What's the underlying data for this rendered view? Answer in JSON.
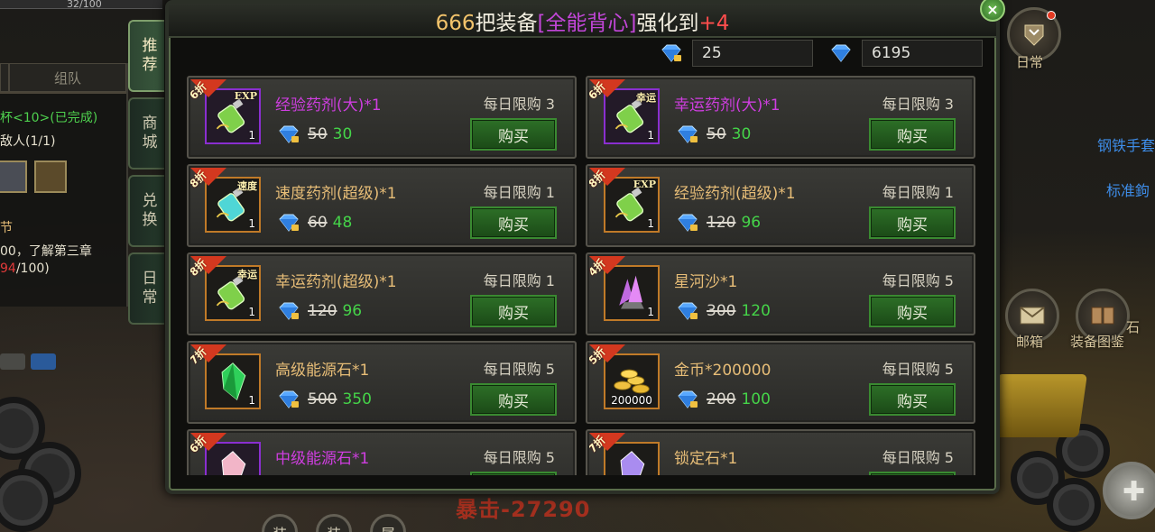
{
  "hud": {
    "hp_text": "32/100",
    "damage_text": "暴击-27290",
    "daily_label": "日常",
    "mail_label": "邮箱",
    "atlas_label": "装备图鉴",
    "side_blue_1": "钢铁手套",
    "side_blue_2": "标准鉤",
    "atlas_partial": "石",
    "bottom_buttons": [
      "装",
      "装",
      "属"
    ]
  },
  "quest": {
    "tabs": [
      "组队"
    ],
    "line1": "杯<10>(已完成)",
    "line2": "敌人(1/1)",
    "line3": "节",
    "line4": "00，了解第三章",
    "line5_red": "94",
    "line5_rest": "/100)"
  },
  "side_tabs": [
    {
      "label": "推荐",
      "active": true
    },
    {
      "label": "商城",
      "active": false
    },
    {
      "label": "兑换",
      "active": false
    },
    {
      "label": "日常",
      "active": false
    }
  ],
  "shop": {
    "title": {
      "count": "666",
      "mid": "把装备",
      "item": "[全能背心]",
      "tail": "强化到",
      "level": "+4"
    },
    "currency": {
      "bound_gems": "25",
      "gems": "6195"
    },
    "buy_label": "购买",
    "items": [
      {
        "name": "经验药剂(大)*1",
        "rarity": "purple",
        "discount": "6折",
        "limit": "每日限购 3",
        "old_price": "50",
        "new_price": "30",
        "qty": "1",
        "icon": "exp-potion-icon",
        "tag": "EXP"
      },
      {
        "name": "幸运药剂(大)*1",
        "rarity": "purple",
        "discount": "6折",
        "limit": "每日限购 3",
        "old_price": "50",
        "new_price": "30",
        "qty": "1",
        "icon": "luck-potion-icon",
        "tag": "幸运"
      },
      {
        "name": "速度药剂(超级)*1",
        "rarity": "gold",
        "discount": "8折",
        "limit": "每日限购 1",
        "old_price": "60",
        "new_price": "48",
        "qty": "1",
        "icon": "speed-potion-icon",
        "tag": "速度"
      },
      {
        "name": "经验药剂(超级)*1",
        "rarity": "gold",
        "discount": "8折",
        "limit": "每日限购 1",
        "old_price": "120",
        "new_price": "96",
        "qty": "1",
        "icon": "exp-potion-icon",
        "tag": "EXP"
      },
      {
        "name": "幸运药剂(超级)*1",
        "rarity": "gold",
        "discount": "8折",
        "limit": "每日限购 1",
        "old_price": "120",
        "new_price": "96",
        "qty": "1",
        "icon": "luck-potion-icon",
        "tag": "幸运"
      },
      {
        "name": "星河沙*1",
        "rarity": "gold",
        "discount": "4折",
        "limit": "每日限购 5",
        "old_price": "300",
        "new_price": "120",
        "qty": "1",
        "icon": "star-sand-crystal-icon",
        "tag": ""
      },
      {
        "name": "高级能源石*1",
        "rarity": "gold",
        "discount": "7折",
        "limit": "每日限购 5",
        "old_price": "500",
        "new_price": "350",
        "qty": "1",
        "icon": "green-energy-stone-icon",
        "tag": ""
      },
      {
        "name": "金币*200000",
        "rarity": "gold",
        "discount": "5折",
        "limit": "每日限购 5",
        "old_price": "200",
        "new_price": "100",
        "qty": "200000",
        "icon": "gold-coins-icon",
        "tag": ""
      },
      {
        "name": "中级能源石*1",
        "rarity": "purple",
        "discount": "6折",
        "limit": "每日限购 5",
        "old_price": "",
        "new_price": "",
        "qty": "",
        "icon": "pink-energy-stone-icon",
        "tag": ""
      },
      {
        "name": "锁定石*1",
        "rarity": "gold",
        "discount": "7折",
        "limit": "每日限购 5",
        "old_price": "",
        "new_price": "",
        "qty": "",
        "icon": "lock-stone-icon",
        "tag": ""
      }
    ]
  },
  "colors": {
    "purple_name": "#cf3ee0",
    "gold_name": "#e7bd77",
    "new_price": "#45d449",
    "discount_ribbon": "#d3381f",
    "buy_button": "#2d6f27"
  }
}
